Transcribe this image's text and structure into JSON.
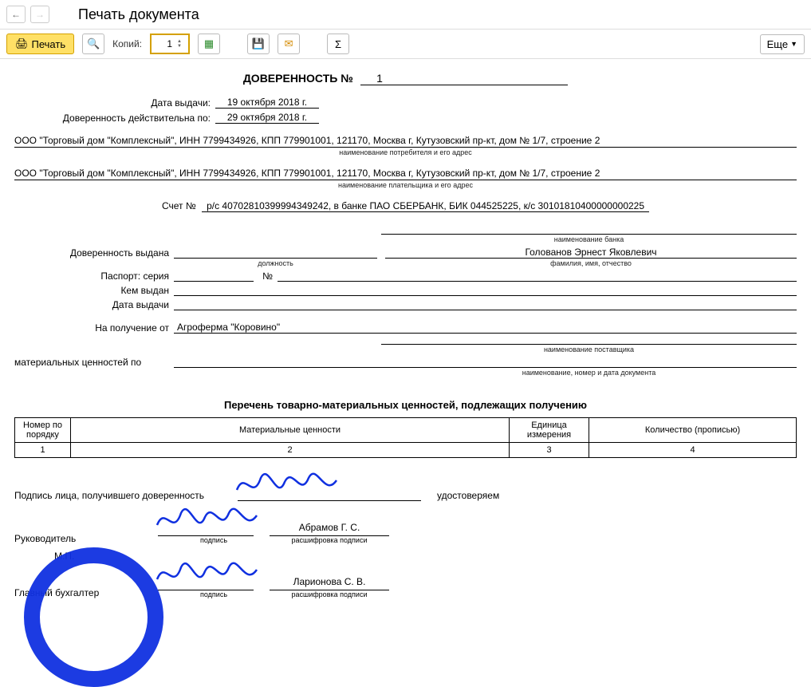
{
  "header": {
    "page_title": "Печать документа",
    "print_label": "Печать",
    "copies_label": "Копий:",
    "copies_value": "1",
    "more_label": "Еще"
  },
  "doc": {
    "title": "ДОВЕРЕННОСТЬ №",
    "number": "1",
    "date_issue_label": "Дата выдачи:",
    "date_issue": "19 октября 2018 г.",
    "valid_until_label": "Доверенность действительна по:",
    "valid_until": "29 октября 2018 г.",
    "consumer_line": "ООО \"Торговый дом \"Комплексный\", ИНН 7799434926, КПП 779901001, 121170, Москва г, Кутузовский пр-кт, дом № 1/7, строение 2",
    "consumer_caption": "наименование потребителя и его адрес",
    "payer_line": "ООО \"Торговый дом \"Комплексный\", ИНН 7799434926, КПП 779901001, 121170, Москва г, Кутузовский пр-кт, дом № 1/7, строение 2",
    "payer_caption": "наименование плательщика и его адрес",
    "account_label": "Счет №",
    "account_text": "р/с 40702810399994349242, в банке ПАО СБЕРБАНК, БИК 044525225, к/с 30101810400000000225",
    "bank_caption": "наименование банка",
    "issued_to_label": "Доверенность выдана",
    "position_caption": "должность",
    "fio_value": "Голованов Эрнест Яковлевич",
    "fio_caption": "фамилия, имя, отчество",
    "passport_label": "Паспорт: серия",
    "passport_num_label": "№",
    "issued_by_label": "Кем выдан",
    "issued_date_label": "Дата выдачи",
    "receive_from_label": "На получение от",
    "supplier_value": "Агроферма \"Коровино\"",
    "supplier_caption": "наименование поставщика",
    "materials_by_label": "материальных ценностей по",
    "materials_caption": "наименование, номер и дата документа",
    "list_title": "Перечень товарно-материальных ценностей, подлежащих получению",
    "table": {
      "headers": [
        "Номер по порядку",
        "Материальные ценности",
        "Единица измерения",
        "Количество (прописью)"
      ],
      "num_row": [
        "1",
        "2",
        "3",
        "4"
      ]
    },
    "sign": {
      "receiver_label": "Подпись лица, получившего доверенность",
      "certify_label": "удостоверяем",
      "manager_label": "Руководитель",
      "mp_label": "М.П.",
      "accountant_label": "Главный бухгалтер",
      "sign_caption": "подпись",
      "decipher_caption": "расшифровка подписи",
      "manager_name": "Абрамов Г. С.",
      "accountant_name": "Ларионова С. В."
    }
  }
}
